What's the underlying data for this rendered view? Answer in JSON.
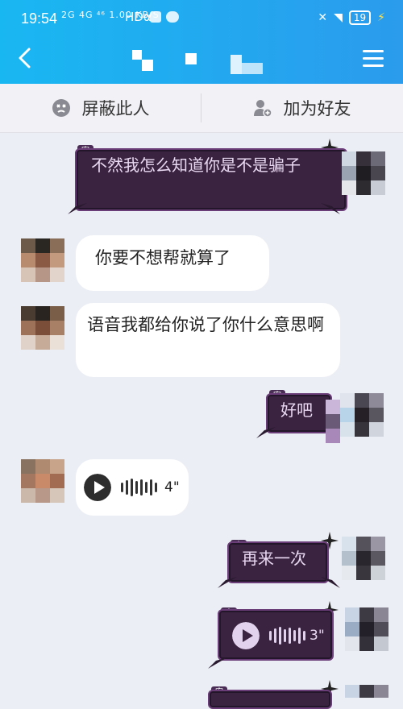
{
  "status": {
    "time": "19:54",
    "network": "2G 4G ⁴⁶ 1.00 KB/S",
    "hd": "HDα",
    "battery": "19"
  },
  "header": {
    "title_obscured": true
  },
  "actions": {
    "block_label": "屏蔽此人",
    "add_friend_label": "加为好友"
  },
  "messages": [
    {
      "side": "right",
      "style": "dark",
      "tag": "宏",
      "text": "不然我怎么知道你是不是骗子"
    },
    {
      "side": "left",
      "style": "bubble",
      "text": "你要不想帮就算了"
    },
    {
      "side": "left",
      "style": "bubble",
      "text": "语音我都给你说了你什么意思啊"
    },
    {
      "side": "right",
      "style": "dark",
      "tag": "宏",
      "text": "好吧"
    },
    {
      "side": "left",
      "style": "voice",
      "duration": "4\""
    },
    {
      "side": "right",
      "style": "dark",
      "tag": "宏",
      "text": "再来一次"
    },
    {
      "side": "right",
      "style": "dark-voice",
      "tag": "宏",
      "duration": "3\""
    },
    {
      "side": "right",
      "style": "dark",
      "tag": "宏",
      "text": ""
    }
  ],
  "colors": {
    "header": "#23a8ef",
    "chat_bg": "#eceef5",
    "dark_bubble": "#3a2340"
  }
}
